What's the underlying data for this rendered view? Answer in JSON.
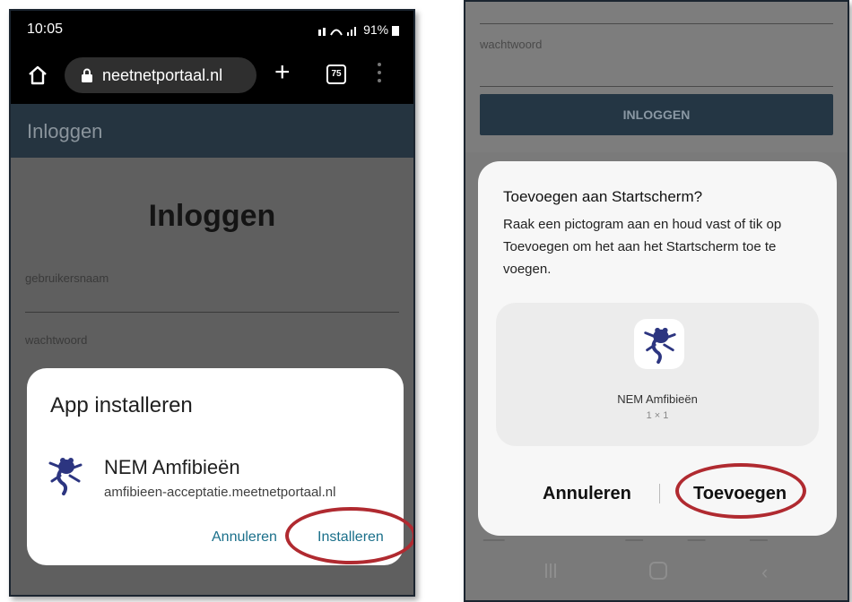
{
  "left": {
    "status": {
      "time": "10:05",
      "right": "91%"
    },
    "browser": {
      "url": "neetnetportaal.nl",
      "tab_count": "75"
    },
    "header_title": "Inloggen",
    "page_title": "Inloggen",
    "username_label": "gebruikersnaam",
    "password_label": "wachtwoord",
    "install_dialog": {
      "title": "App installeren",
      "app_name": "NEM Amfibieën",
      "app_url": "amfibieen-acceptatie.meetnetportaal.nl",
      "cancel": "Annuleren",
      "install": "Installeren"
    }
  },
  "right": {
    "password_label": "wachtwoord",
    "login_button": "INLOGGEN",
    "dialog": {
      "title": "Toevoegen aan Startscherm?",
      "text": "Raak een pictogram aan en houd vast of tik op Toevoegen om het aan het Startscherm toe te voegen.",
      "app_name": "NEM Amfibieën",
      "app_size": "1 × 1",
      "cancel": "Annuleren",
      "add": "Toevoegen"
    }
  },
  "colors": {
    "highlight": "#b02a30",
    "accent": "#1a6f8a",
    "brand_dark": "#243644",
    "frog": "#2c3580"
  },
  "icons": [
    "home-icon",
    "lock-icon",
    "plus-icon",
    "tabs-icon",
    "more-vert-icon",
    "frog-app-icon",
    "recent-apps-icon",
    "home-nav-icon",
    "back-icon"
  ]
}
